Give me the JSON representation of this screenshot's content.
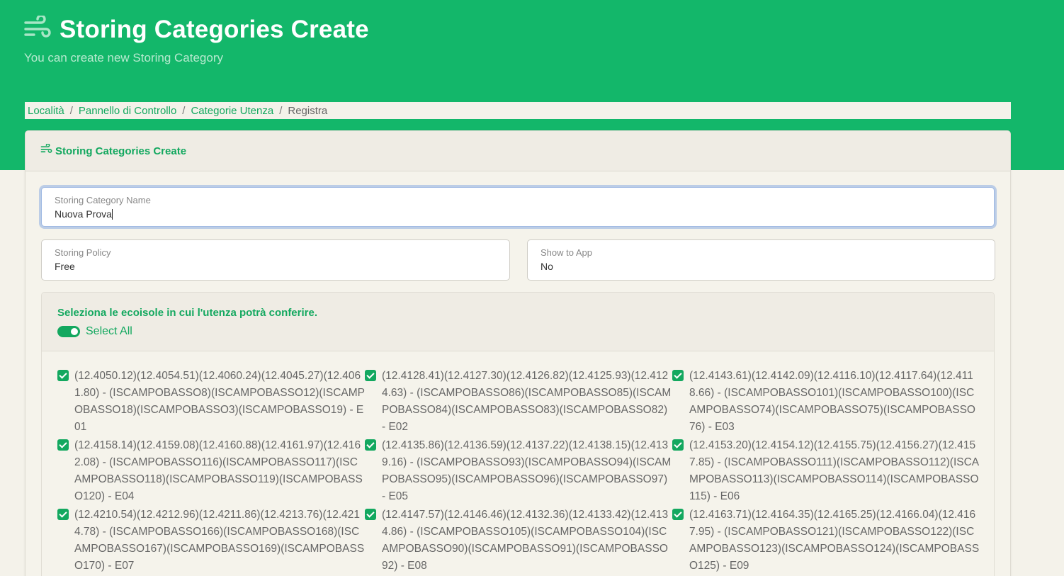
{
  "page": {
    "title": "Storing Categories Create",
    "subtitle": "You can create new Storing Category"
  },
  "breadcrumb": {
    "items": [
      "Località",
      "Pannello di Controllo",
      "Categorie Utenza"
    ],
    "current": "Registra",
    "separator": "/"
  },
  "card": {
    "title": "Storing Categories Create"
  },
  "form": {
    "name_label": "Storing Category Name",
    "name_value": "Nuova Prova",
    "policy_label": "Storing Policy",
    "policy_value": "Free",
    "show_label": "Show to App",
    "show_value": "No"
  },
  "ecoisole": {
    "prompt": "Seleziona le ecoisole in cui l'utenza potrà conferire.",
    "select_all_label": "Select All",
    "select_all_on": true,
    "items": [
      {
        "text": "(12.4050.12)(12.4054.51)(12.4060.24)(12.4045.27)(12.4061.80) - (ISCAMPOBASSO8)(ISCAMPOBASSO12)(ISCAMPOBASSO18)(ISCAMPOBASSO3)(ISCAMPOBASSO19) - E01",
        "checked": true
      },
      {
        "text": "(12.4128.41)(12.4127.30)(12.4126.82)(12.4125.93)(12.4124.63) - (ISCAMPOBASSO86)(ISCAMPOBASSO85)(ISCAMPOBASSO84)(ISCAMPOBASSO83)(ISCAMPOBASSO82) - E02",
        "checked": true
      },
      {
        "text": "(12.4143.61)(12.4142.09)(12.4116.10)(12.4117.64)(12.4118.66) - (ISCAMPOBASSO101)(ISCAMPOBASSO100)(ISCAMPOBASSO74)(ISCAMPOBASSO75)(ISCAMPOBASSO76) - E03",
        "checked": true
      },
      {
        "text": "(12.4158.14)(12.4159.08)(12.4160.88)(12.4161.97)(12.4162.08) - (ISCAMPOBASSO116)(ISCAMPOBASSO117)(ISCAMPOBASSO118)(ISCAMPOBASSO119)(ISCAMPOBASSO120) - E04",
        "checked": true
      },
      {
        "text": "(12.4135.86)(12.4136.59)(12.4137.22)(12.4138.15)(12.4139.16) - (ISCAMPOBASSO93)(ISCAMPOBASSO94)(ISCAMPOBASSO95)(ISCAMPOBASSO96)(ISCAMPOBASSO97) - E05",
        "checked": true
      },
      {
        "text": "(12.4153.20)(12.4154.12)(12.4155.75)(12.4156.27)(12.4157.85) - (ISCAMPOBASSO111)(ISCAMPOBASSO112)(ISCAMPOBASSO113)(ISCAMPOBASSO114)(ISCAMPOBASSO115) - E06",
        "checked": true
      },
      {
        "text": "(12.4210.54)(12.4212.96)(12.4211.86)(12.4213.76)(12.4214.78) - (ISCAMPOBASSO166)(ISCAMPOBASSO168)(ISCAMPOBASSO167)(ISCAMPOBASSO169)(ISCAMPOBASSO170) - E07",
        "checked": true
      },
      {
        "text": "(12.4147.57)(12.4146.46)(12.4132.36)(12.4133.42)(12.4134.86) - (ISCAMPOBASSO105)(ISCAMPOBASSO104)(ISCAMPOBASSO90)(ISCAMPOBASSO91)(ISCAMPOBASSO92) - E08",
        "checked": true
      },
      {
        "text": "(12.4163.71)(12.4164.35)(12.4165.25)(12.4166.04)(12.4167.95) - (ISCAMPOBASSO121)(ISCAMPOBASSO122)(ISCAMPOBASSO123)(ISCAMPOBASSO124)(ISCAMPOBASSO125) - E09",
        "checked": true
      }
    ]
  },
  "colors": {
    "brand_green": "#13b76a",
    "accent_green": "#13a85f",
    "background": "#f4f2ea"
  },
  "icons": {
    "title_icon": "wind-icon"
  }
}
